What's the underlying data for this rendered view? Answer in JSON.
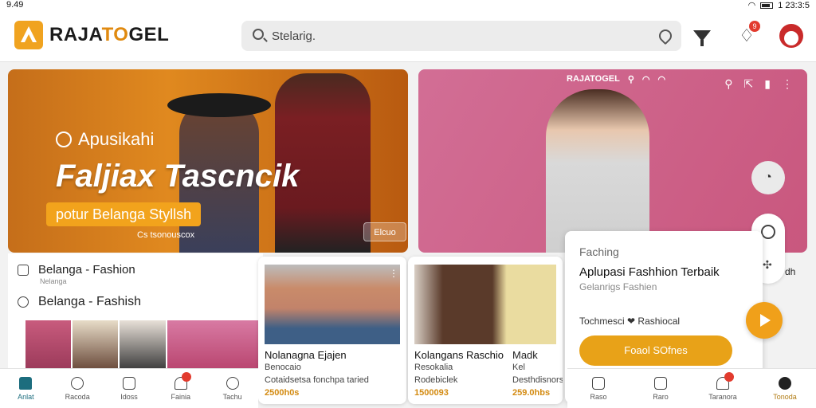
{
  "status": {
    "time": "9.49",
    "clock_right": "1 23:3:5"
  },
  "header": {
    "logo_main": "RAJA",
    "logo_accent": "TO",
    "logo_tail": "GEL",
    "search_value": "Stelarig.",
    "notification_count": "9",
    "icons": [
      "filter-icon",
      "bell-icon",
      "avatar"
    ]
  },
  "hero_left": {
    "subtitle": "Apusikahi",
    "headline": "Faljiax Tascncik",
    "tagline": "potur Belanga Styllsh",
    "small_text": "Cs tsonouscox",
    "cta": "Elcuo"
  },
  "hero_right": {
    "brand": "RAJATOGEL"
  },
  "list": {
    "row1_label": "Belanga - Fashion",
    "row1_sub": "Nelanga",
    "row2_label": "Belanga - Fashish"
  },
  "cards": [
    {
      "title": "Nolanagna Ejajen",
      "line1": "Benocaio",
      "line2": "Cotaidsetsa fonchpa taried",
      "price": "2500h0s"
    },
    {
      "title": "Kolangans Raschio",
      "line1": "Resokalia",
      "line2": "Rodebiclek",
      "price": "1500093"
    }
  ],
  "card_edge": {
    "title": "Madk",
    "line1": "Kel",
    "line2": "Desthdisnorsh",
    "price": "259.0hbs"
  },
  "panel": {
    "label": "Faching",
    "title": "Aplupasi Fashhion Terbaik",
    "subtitle": "Gelanrigs Fashien",
    "meta": "Tochmesci ❤ Rashiocal",
    "button": "Foaol SOfnes"
  },
  "edge_label": "dh",
  "bottom_nav_left": [
    {
      "label": "Anlat",
      "active": true
    },
    {
      "label": "Racoda"
    },
    {
      "label": "Idoss"
    },
    {
      "label": "Fainia",
      "badge": true
    },
    {
      "label": "Tachu"
    }
  ],
  "bottom_nav_right": [
    {
      "label": "Raso"
    },
    {
      "label": "Raro"
    },
    {
      "label": "Taranora",
      "badge": true
    },
    {
      "label": "Tonoda",
      "gold": true
    }
  ],
  "colors": {
    "accent": "#f0a320",
    "nav_active": "#1c6d7e",
    "badge": "#e23b2e"
  }
}
